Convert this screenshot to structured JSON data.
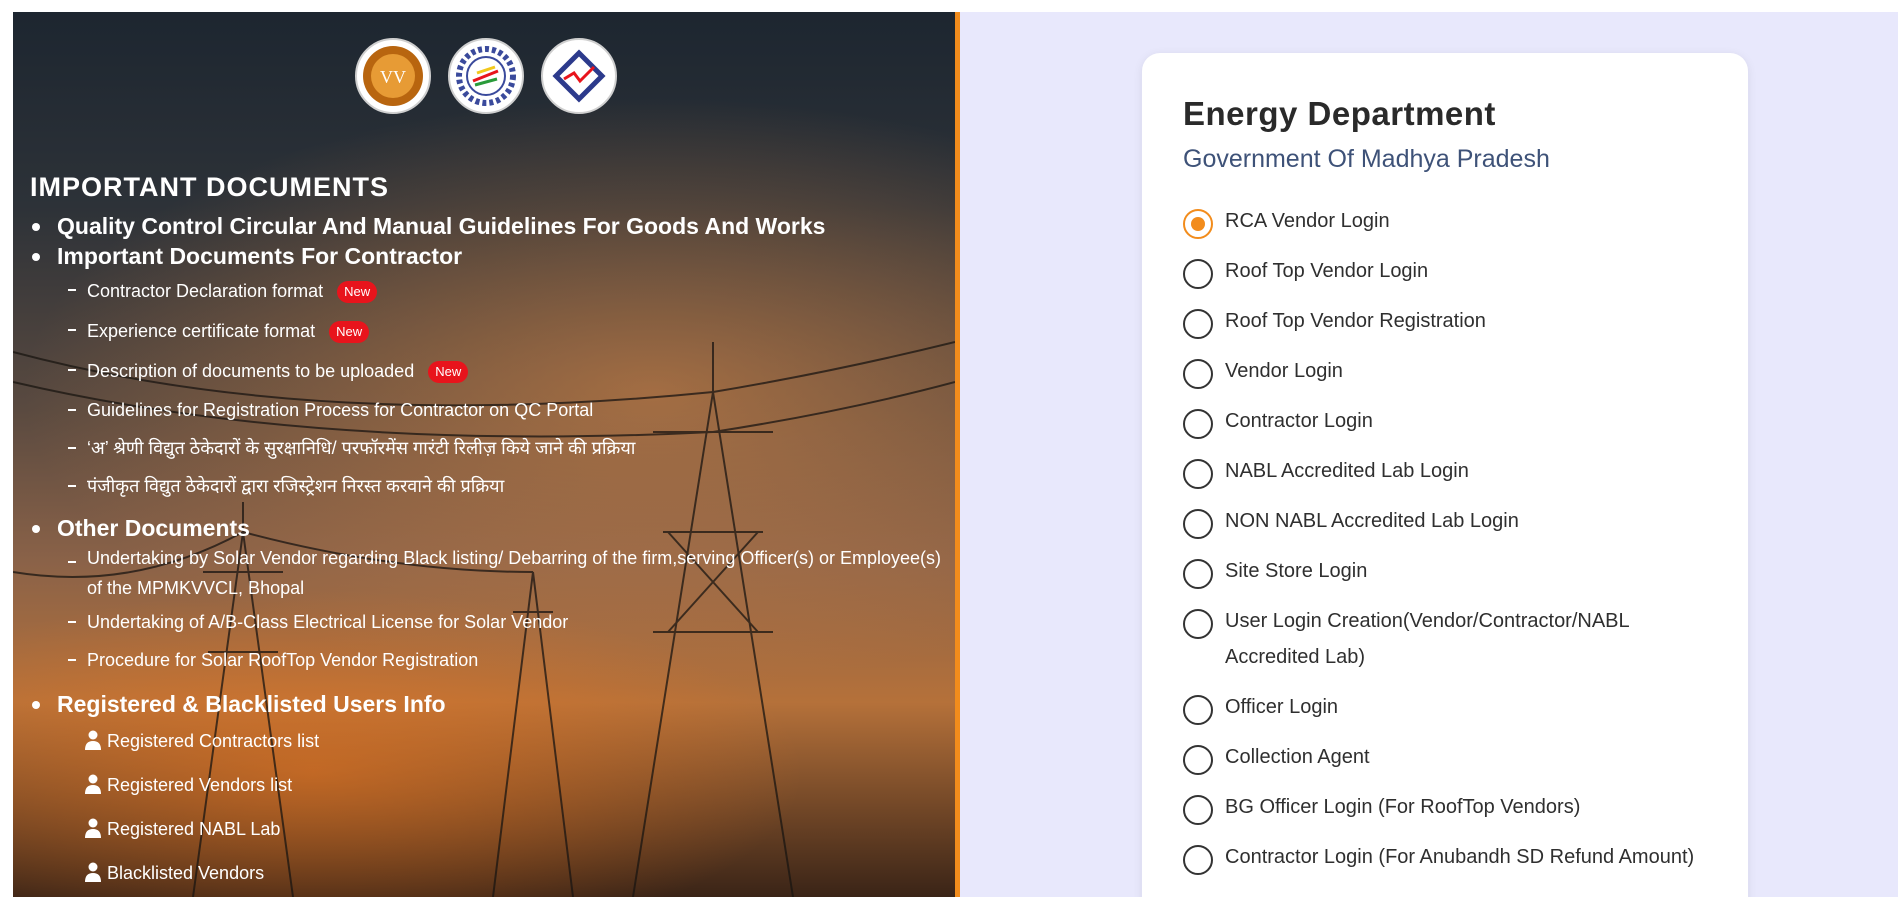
{
  "logos": [
    {
      "name": "vv-logo",
      "text": "VV"
    },
    {
      "name": "gear-logo"
    },
    {
      "name": "diamond-logo"
    }
  ],
  "left": {
    "title": "IMPORTANT DOCUMENTS",
    "sections": [
      {
        "heading": "Quality Control Circular And Manual Guidelines For Goods And Works",
        "items": []
      },
      {
        "heading": "Important Documents For Contractor",
        "items": [
          {
            "label": "Contractor Declaration format",
            "badge": "New"
          },
          {
            "label": "Experience certificate format",
            "badge": "New"
          },
          {
            "label": "Description of documents to be uploaded",
            "badge": "New"
          },
          {
            "label": "Guidelines for Registration Process for Contractor on QC Portal"
          },
          {
            "label": "‘अ’ श्रेणी विद्युत ठेकेदारों के सुरक्षानिधि/ परफॉरमेंस गारंटी रिलीज़ किये जाने की प्रक्रिया"
          },
          {
            "label": "पंजीकृत विद्युत ठेकेदारों द्वारा रजिस्ट्रेशन निरस्त करवाने की प्रक्रिया"
          }
        ]
      },
      {
        "heading": "Other Documents",
        "items": [
          {
            "label": "Undertaking by Solar Vendor regarding Black listing/ Debarring of the firm,serving Officer(s) or Employee(s) of the MPMKVVCL, Bhopal"
          },
          {
            "label": "Undertaking of A/B-Class Electrical License for Solar Vendor"
          },
          {
            "label": "Procedure for Solar RoofTop Vendor Registration"
          }
        ]
      }
    ],
    "users_heading": "Registered & Blacklisted Users Info",
    "users": [
      {
        "label": "Registered Contractors list"
      },
      {
        "label": "Registered Vendors list"
      },
      {
        "label": "Registered NABL Lab"
      },
      {
        "label": "Blacklisted Vendors"
      }
    ]
  },
  "card": {
    "title": "Energy Department",
    "subtitle": "Government Of Madhya Pradesh",
    "selected_index": 0,
    "options": [
      "RCA Vendor Login",
      "Roof Top Vendor Login",
      "Roof Top Vendor Registration",
      "Vendor Login",
      "Contractor Login",
      "NABL Accredited Lab Login",
      "NON NABL Accredited Lab Login",
      "Site Store Login",
      "User Login Creation(Vendor/Contractor/NABL Accredited Lab)",
      "Officer Login",
      "Collection Agent",
      "BG Officer Login (For RoofTop Vendors)",
      "Contractor Login (For Anubandh SD Refund Amount)"
    ]
  },
  "colors": {
    "accent": "#f28c1c",
    "badge": "#e8141c",
    "right_bg": "#e8e8fc"
  }
}
